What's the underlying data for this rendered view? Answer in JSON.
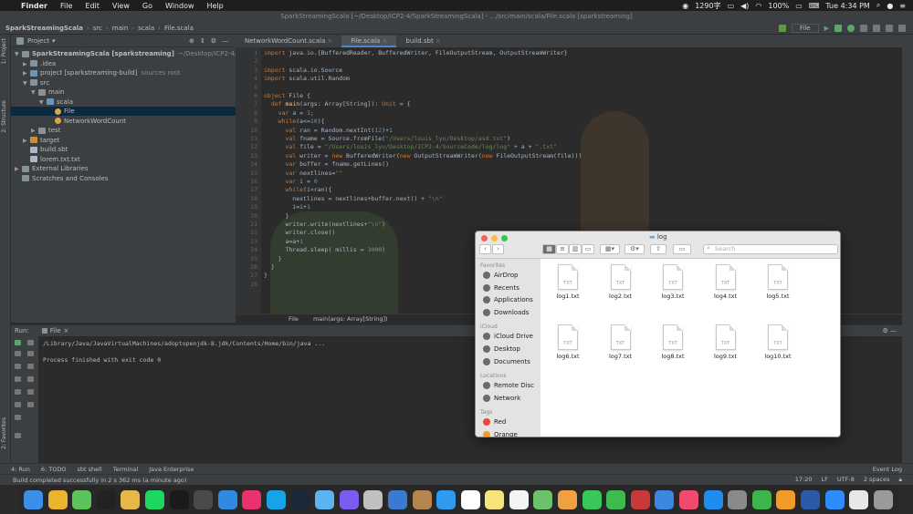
{
  "menubar": {
    "apple": "",
    "items": [
      "Finder",
      "File",
      "Edit",
      "View",
      "Go",
      "Window",
      "Help"
    ],
    "right": {
      "wechat_icon": "wechat-icon",
      "speed": "1290字",
      "battery": "100%",
      "clock": "Tue 4:34 PM"
    }
  },
  "ide": {
    "window_title": "SparkStreamingScala [~/Desktop/ICP2-4/SparkStreamingScala] - .../src/main/scala/File.scala [sparkstreaming]",
    "breadcrumbs": [
      "SparkStreamingScala",
      "src",
      "main",
      "scala",
      "File.scala"
    ],
    "run_config": "File",
    "project_label": "Project",
    "tree": [
      {
        "label": "SparkStreamingScala [sparkstreaming]",
        "suffix": "~/Desktop/ICP2-4/SparkStreamingSca",
        "indent": 0,
        "arrow": "▼",
        "icon": "folder"
      },
      {
        "label": ".idea",
        "suffix": "",
        "indent": 1,
        "arrow": "▶",
        "icon": "folder"
      },
      {
        "label": "project [sparkstreaming-build]",
        "suffix": "sources root",
        "indent": 1,
        "arrow": "▶",
        "icon": "folder blue"
      },
      {
        "label": "src",
        "suffix": "",
        "indent": 1,
        "arrow": "▼",
        "icon": "folder"
      },
      {
        "label": "main",
        "suffix": "",
        "indent": 2,
        "arrow": "▼",
        "icon": "folder"
      },
      {
        "label": "scala",
        "suffix": "",
        "indent": 3,
        "arrow": "▼",
        "icon": "folder blue"
      },
      {
        "label": "File",
        "suffix": "",
        "indent": 4,
        "arrow": "",
        "icon": "classic",
        "selected": true
      },
      {
        "label": "NetworkWordCount",
        "suffix": "",
        "indent": 4,
        "arrow": "",
        "icon": "classic"
      },
      {
        "label": "test",
        "suffix": "",
        "indent": 2,
        "arrow": "▶",
        "icon": "folder"
      },
      {
        "label": "target",
        "suffix": "",
        "indent": 1,
        "arrow": "▶",
        "icon": "folder orange"
      },
      {
        "label": "build.sbt",
        "suffix": "",
        "indent": 1,
        "arrow": "",
        "icon": "fileic"
      },
      {
        "label": "lorem.txt.txt",
        "suffix": "",
        "indent": 1,
        "arrow": "",
        "icon": "fileic"
      },
      {
        "label": "External Libraries",
        "suffix": "",
        "indent": 0,
        "arrow": "▶",
        "icon": "folder"
      },
      {
        "label": "Scratches and Consoles",
        "suffix": "",
        "indent": 0,
        "arrow": "",
        "icon": "folder"
      }
    ],
    "tabs": [
      "NetworkWordCount.scala",
      "File.scala",
      "build.sbt"
    ],
    "active_tab": 1,
    "code_lines": [
      "import java.io.{BufferedReader, BufferedWriter, FileOutputStream, OutputStreamWriter}",
      "",
      "import scala.io.Source",
      "import scala.util.Random",
      "",
      "object File {",
      "  def main(args: Array[String]): Unit = {",
      "    var a = 1;",
      "    while(a<=10){",
      "      val ran = Random.nextInt(12)+1",
      "      val fname = Source.fromFile(\"/Users/louis_lyu/Desktop/asd.txt\")",
      "      val file = \"/Users/louis_lyu/Desktop/ICP2-4/SourceCode/log/log\" + a + \".txt\"",
      "      val writer = new BufferedWriter(new OutputStreamWriter(new FileOutputStream(file)))",
      "      var buffer = fname.getLines()",
      "      var nextlines=\"\"",
      "      var i = 0",
      "      while(i<ran){",
      "        nextlines = nextlines+buffer.next() + \"\\n\"",
      "        i=i+1",
      "      }",
      "      writer.write(nextlines+\"\\n\")",
      "      writer.close()",
      "      a=a+1",
      "      Thread.sleep( millis = 3000)",
      "    }",
      "  }",
      "}",
      ""
    ],
    "editor_breadcrumb": [
      "File",
      "main(args: Array[String])"
    ],
    "run": {
      "label": "Run:",
      "tab": "File",
      "lines": [
        "/Library/Java/JavaVirtualMachines/adoptopenjdk-8.jdk/Contents/Home/bin/java ...",
        "",
        "Process finished with exit code 0"
      ]
    },
    "tool_windows": [
      "4: Run",
      "6: TODO",
      "sbt shell",
      "Terminal",
      "Java Enterprise"
    ],
    "event_log": "Event Log",
    "status_message": "Build completed successfully in 2 s 362 ms (a minute ago)",
    "status_right": [
      "17:20",
      "LF",
      "UTF-8",
      "2 spaces"
    ],
    "left_stripe": [
      "1: Project",
      "2: Structure",
      "2: Favorites"
    ]
  },
  "finder": {
    "title": "log",
    "search_placeholder": "Search",
    "sidebar": [
      {
        "type": "head",
        "label": "Favorites"
      },
      {
        "type": "item",
        "label": "AirDrop",
        "icon": "airdrop-icon"
      },
      {
        "type": "item",
        "label": "Recents",
        "icon": "recents-icon"
      },
      {
        "type": "item",
        "label": "Applications",
        "icon": "applications-icon"
      },
      {
        "type": "item",
        "label": "Downloads",
        "icon": "downloads-icon"
      },
      {
        "type": "head",
        "label": "iCloud"
      },
      {
        "type": "item",
        "label": "iCloud Drive",
        "icon": "cloud-icon"
      },
      {
        "type": "item",
        "label": "Desktop",
        "icon": "desktop-icon"
      },
      {
        "type": "item",
        "label": "Documents",
        "icon": "documents-icon"
      },
      {
        "type": "head",
        "label": "Locations"
      },
      {
        "type": "item",
        "label": "Remote Disc",
        "icon": "disc-icon"
      },
      {
        "type": "item",
        "label": "Network",
        "icon": "network-icon"
      },
      {
        "type": "head",
        "label": "Tags"
      },
      {
        "type": "item",
        "label": "Red",
        "icon": "tag-red-icon",
        "color": "#e8453c"
      },
      {
        "type": "item",
        "label": "Orange",
        "icon": "tag-orange-icon",
        "color": "#f39a2b"
      }
    ],
    "files": [
      "log1.txt",
      "log2.txt",
      "log3.txt",
      "log4.txt",
      "log5.txt",
      "log6.txt",
      "log7.txt",
      "log8.txt",
      "log9.txt",
      "log10.txt"
    ],
    "file_ext": "TXT"
  },
  "dock": {
    "apps": [
      {
        "name": "finder-icon",
        "color": "#3d8ee8"
      },
      {
        "name": "chrome-icon",
        "color": "#e9b52f"
      },
      {
        "name": "wechat-icon",
        "color": "#5cc35a"
      },
      {
        "name": "qq-icon",
        "color": "#222222"
      },
      {
        "name": "gold-app-icon",
        "color": "#e6b84a"
      },
      {
        "name": "spotify-icon",
        "color": "#1ed760"
      },
      {
        "name": "terminal-icon",
        "color": "#1a1a1a"
      },
      {
        "name": "sublime-icon",
        "color": "#4a4a4a"
      },
      {
        "name": "app-store-alt-icon",
        "color": "#2f8be0"
      },
      {
        "name": "intellij-icon",
        "color": "#e8336e"
      },
      {
        "name": "webstorm-icon",
        "color": "#18a3e8"
      },
      {
        "name": "steam-icon",
        "color": "#1b2838"
      },
      {
        "name": "vr-icon",
        "color": "#5bb3f0"
      },
      {
        "name": "siri-icon",
        "color": "#7a5cf0"
      },
      {
        "name": "launchpad-icon",
        "color": "#c0c0c0"
      },
      {
        "name": "preview-icon",
        "color": "#3a7ad0"
      },
      {
        "name": "notebook-icon",
        "color": "#b58550"
      },
      {
        "name": "safari-icon",
        "color": "#2f9bf0"
      },
      {
        "name": "calendar-icon",
        "color": "#ffffff"
      },
      {
        "name": "notes-icon",
        "color": "#f6e47a"
      },
      {
        "name": "reminders-icon",
        "color": "#f4f4f4"
      },
      {
        "name": "maps-icon",
        "color": "#6bc26b"
      },
      {
        "name": "photos-icon",
        "color": "#f0a040"
      },
      {
        "name": "messages-icon",
        "color": "#39c75a"
      },
      {
        "name": "facetime-icon",
        "color": "#3dbb4d"
      },
      {
        "name": "photo-booth-icon",
        "color": "#c83a3a"
      },
      {
        "name": "keynote-icon",
        "color": "#3a88e0"
      },
      {
        "name": "music-icon",
        "color": "#f04a6e"
      },
      {
        "name": "app-store-icon",
        "color": "#1f8cf0"
      },
      {
        "name": "system-preferences-icon",
        "color": "#8a8a8a"
      },
      {
        "name": "numbers-icon",
        "color": "#3cb54a"
      },
      {
        "name": "pages-icon",
        "color": "#f09a2a"
      },
      {
        "name": "word-icon",
        "color": "#2b5aa8"
      },
      {
        "name": "zoom-icon",
        "color": "#2d8cff"
      },
      {
        "name": "document-icon",
        "color": "#e8e8e8"
      },
      {
        "name": "trash-icon",
        "color": "#9a9a9a"
      }
    ]
  }
}
